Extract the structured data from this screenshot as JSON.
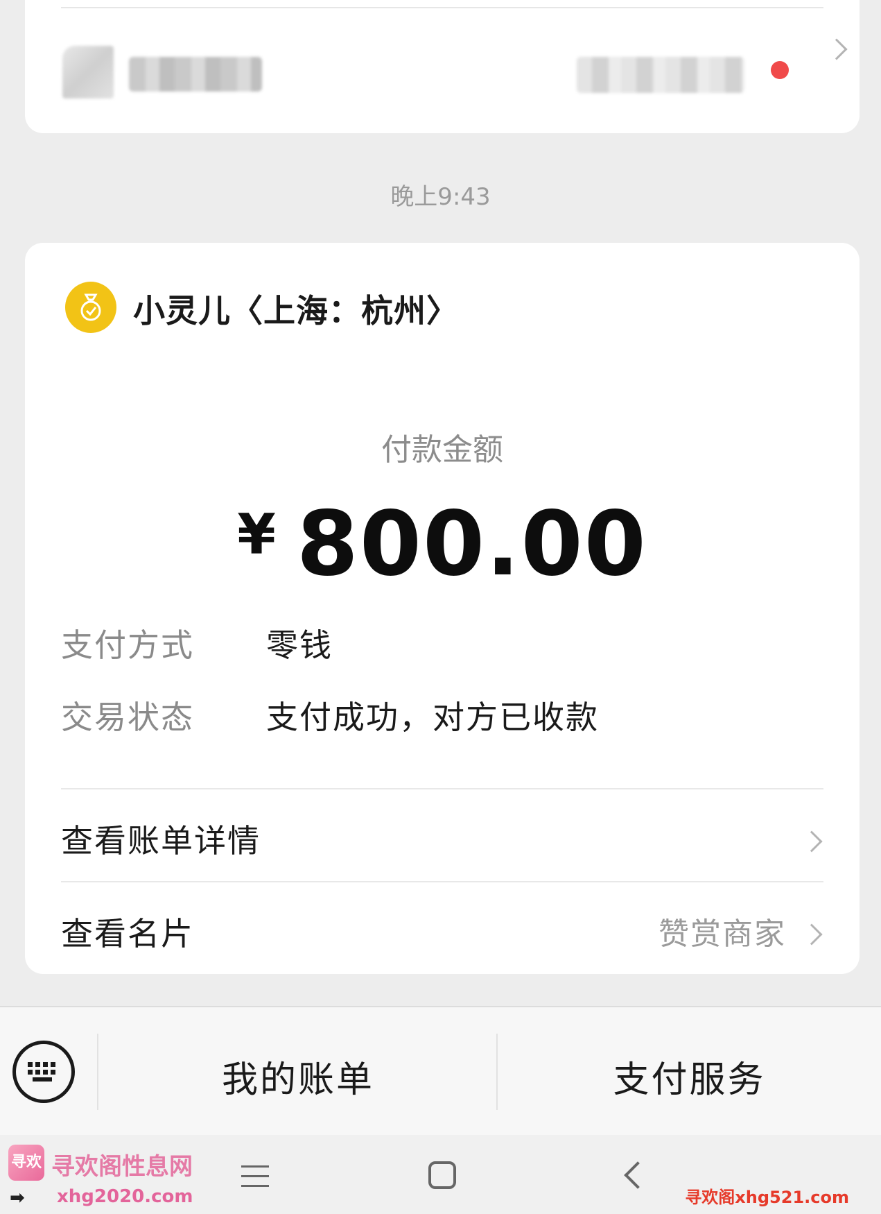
{
  "timestamp": "晚上9:43",
  "payment": {
    "merchant_name": "小灵儿〈上海：杭州〉",
    "amount_label": "付款金额",
    "currency_symbol": "¥",
    "amount": "800.00",
    "method_label": "支付方式",
    "method_value": "零钱",
    "status_label": "交易状态",
    "status_value": "支付成功，对方已收款",
    "rows": [
      {
        "label": "查看账单详情",
        "right": ""
      },
      {
        "label": "查看名片",
        "right": "赞赏商家"
      }
    ]
  },
  "menu": {
    "items": [
      "我的账单",
      "支付服务"
    ]
  },
  "watermarks": {
    "left_title": "寻欢阁性息网",
    "left_url": "xhg2020.com",
    "right_text": "寻欢阁xhg521.com",
    "logo_text": "寻欢"
  },
  "colors": {
    "merchant_icon": "#f2c316",
    "notification_dot": "#f04a4a",
    "background": "#ededed"
  },
  "icons": [
    "chevron-right-icon",
    "money-bag-icon",
    "keyboard-icon",
    "menu-lines-icon",
    "home-square-icon",
    "back-chevron-icon"
  ]
}
